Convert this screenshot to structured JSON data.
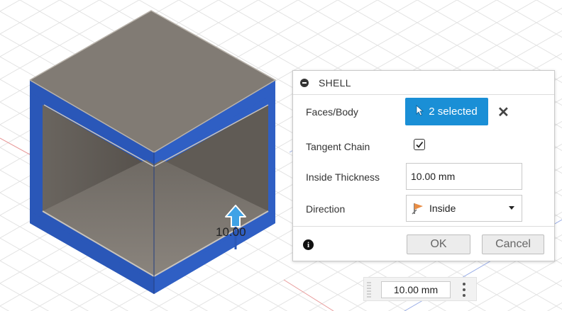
{
  "shell_panel": {
    "title": "SHELL",
    "faces_body": {
      "label": "Faces/Body",
      "selection_text": "2 selected"
    },
    "tangent_chain": {
      "label": "Tangent Chain",
      "checked": true
    },
    "inside_thickness": {
      "label": "Inside Thickness",
      "value": "10.00 mm"
    },
    "direction": {
      "label": "Direction",
      "value": "Inside"
    },
    "ok_label": "OK",
    "cancel_label": "Cancel"
  },
  "viewport": {
    "dimension_label": "10.00"
  },
  "mini_toolbar": {
    "value": "10.00 mm"
  },
  "colors": {
    "accent": "#1a8fd6",
    "body_blue": "#2a57b8",
    "body_face": "#807a73"
  },
  "icons": [
    "collapse-icon",
    "cursor-icon",
    "close-icon",
    "checkmark-icon",
    "flag-icon",
    "chevron-down-icon",
    "info-icon",
    "kebab-menu-icon",
    "manipulator-arrow-icon"
  ]
}
